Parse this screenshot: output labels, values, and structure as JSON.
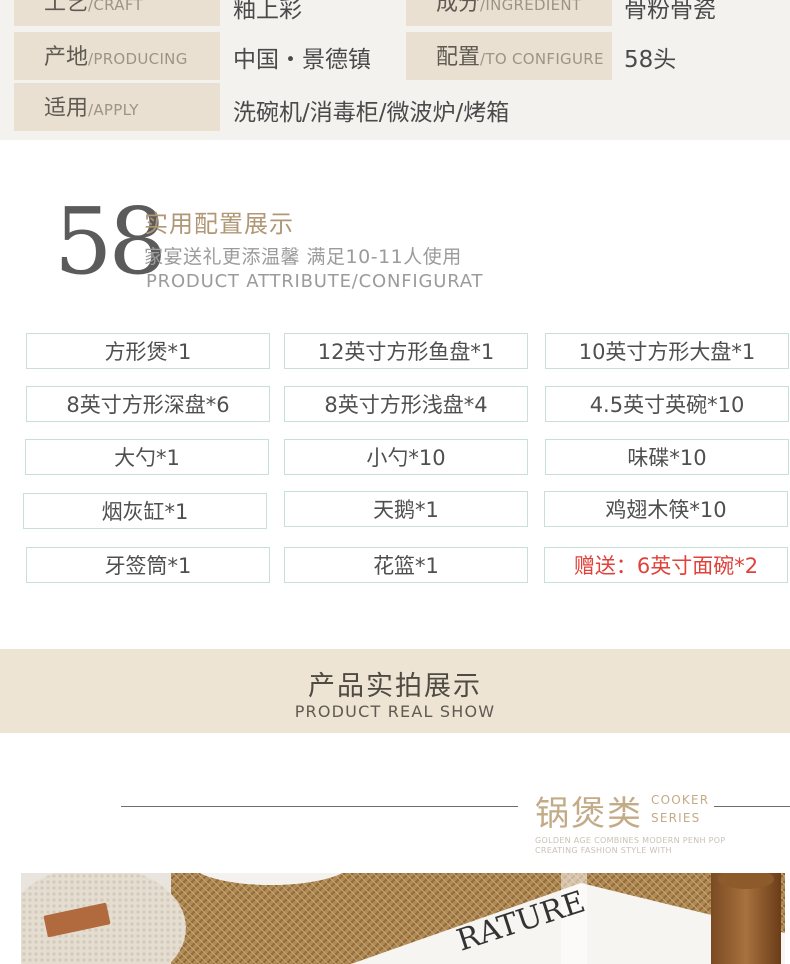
{
  "spec": {
    "rows": [
      {
        "label_cn": "工艺",
        "label_en": "/CRAFT",
        "value": "釉上彩",
        "label2_cn": "成分",
        "label2_en": "/INGREDIENT",
        "value2": "骨粉骨瓷"
      },
      {
        "label_cn": "产地",
        "label_en": "/PRODUCING",
        "value": "中国・景德镇",
        "label2_cn": "配置",
        "label2_en": "/TO CONFIGURE",
        "value2": "58头"
      },
      {
        "label_cn": "适用",
        "label_en": "/APPLY",
        "value": "洗碗机/消毒柜/微波炉/烤箱"
      }
    ]
  },
  "config": {
    "number": "58",
    "title": "实用配置展示",
    "subtitle": "家宴送礼更添温馨  满足10-11人使用",
    "subtitle_en": "PRODUCT ATTRIBUTE/CONFIGURAT",
    "items": [
      "方形煲*1",
      "12英寸方形鱼盘*1",
      "10英寸方形大盘*1",
      "8英寸方形深盘*6",
      "8英寸方形浅盘*4",
      "4.5英寸英碗*10",
      "大勺*1",
      "小勺*10",
      "味碟*10",
      "烟灰缸*1",
      "天鹅*1",
      "鸡翅木筷*10",
      "牙签筒*1",
      "花篮*1",
      "赠送：6英寸面碗*2"
    ],
    "gift_color": "#e0413a",
    "border_color": "#c9dfd9"
  },
  "band": {
    "title": "产品实拍展示",
    "title_en": "PRODUCT REAL SHOW"
  },
  "cooker": {
    "title": "锅煲类",
    "en_line1": "COOKER",
    "en_line2": "SERIES",
    "tag_line1": "GOLDEN AGE COMBINES MODERN PENH POP",
    "tag_line2": "CREATING FASHION STYLE WITH"
  },
  "photo": {
    "lettering": "RATURE"
  },
  "colors": {
    "accent": "#b09776",
    "label_bg": "#e9e0d1",
    "band_bg": "#ede4d3"
  }
}
